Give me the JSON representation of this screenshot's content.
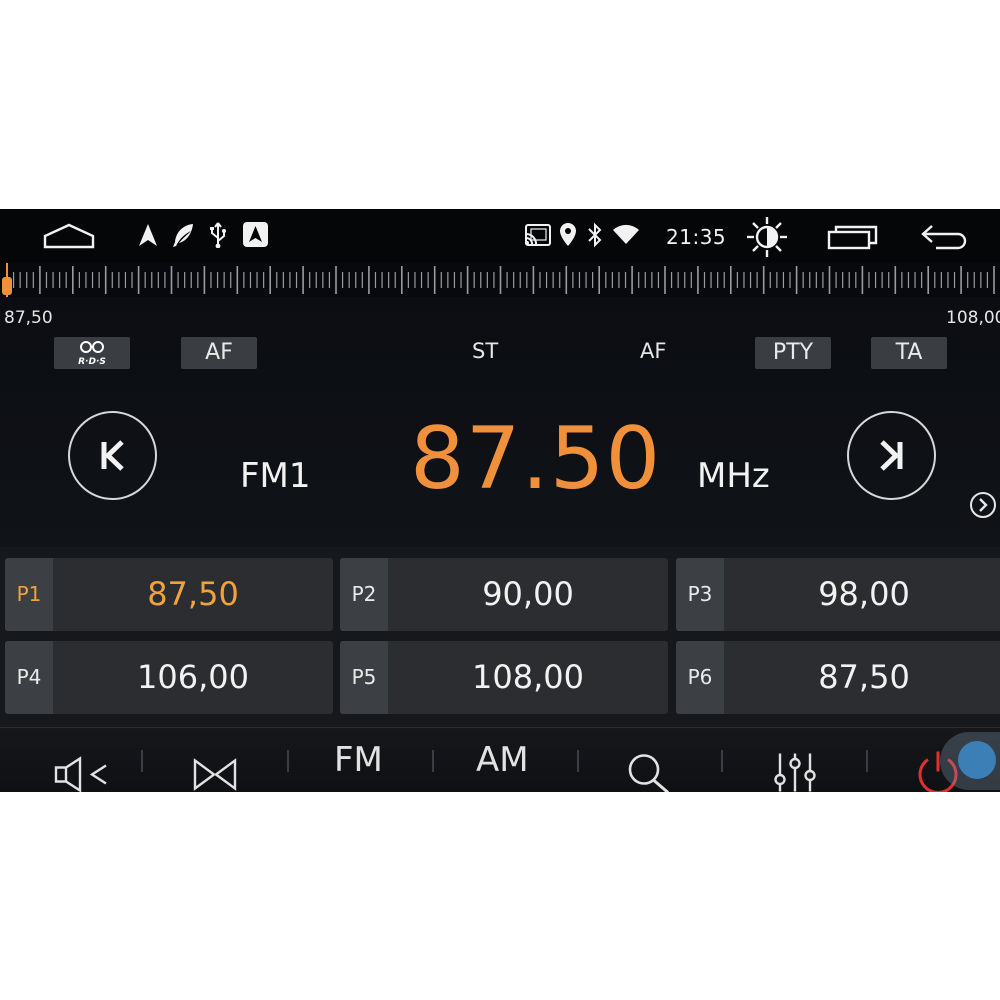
{
  "status_bar": {
    "time": "21:35",
    "icons": [
      "home-icon",
      "navigation-icon",
      "feather-icon",
      "usb-icon",
      "carplay-icon",
      "cast-icon",
      "location-icon",
      "bluetooth-icon",
      "wifi-icon",
      "brightness-icon",
      "recent-apps-icon",
      "back-icon"
    ]
  },
  "tuner": {
    "min_label": "87,50",
    "max_label": "108,00",
    "current": 87.5,
    "min": 87.5,
    "max": 108.0
  },
  "tags": {
    "rds_logo_text": "R·D·S",
    "af_button": "AF",
    "st_indicator": "ST",
    "af_indicator": "AF",
    "pty_button": "PTY",
    "ta_button": "TA"
  },
  "radio": {
    "band": "FM1",
    "frequency": "87.50",
    "unit": "MHz",
    "prev_icon": "seek-back-icon",
    "next_icon": "seek-forward-icon"
  },
  "presets": [
    {
      "label": "P1",
      "freq": "87,50",
      "active": true
    },
    {
      "label": "P2",
      "freq": "90,00",
      "active": false
    },
    {
      "label": "P3",
      "freq": "98,00",
      "active": false
    },
    {
      "label": "P4",
      "freq": "106,00",
      "active": false
    },
    {
      "label": "P5",
      "freq": "108,00",
      "active": false
    },
    {
      "label": "P6",
      "freq": "87,50",
      "active": false
    }
  ],
  "bottom_bar": {
    "fm_label": "FM",
    "am_label": "AM",
    "icons": [
      "volume-icon",
      "stereo-icon",
      "search-icon",
      "equalizer-icon",
      "power-icon"
    ]
  },
  "colors": {
    "accent": "#f0903a",
    "preset_active": "#f0a23c",
    "power": "#e03030"
  }
}
